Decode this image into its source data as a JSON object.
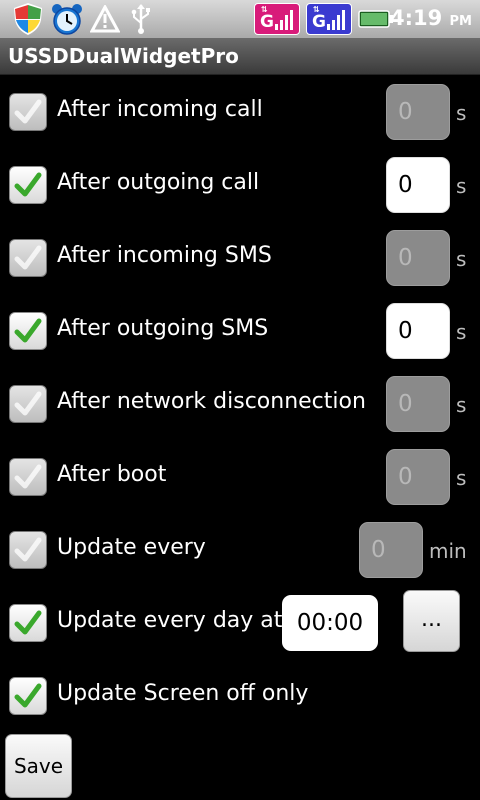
{
  "status_bar": {
    "time": "4:19",
    "ampm": "PM",
    "sim1_label": "G",
    "sim2_label": "G",
    "sim1_color": "#d81b7a",
    "sim2_color": "#3a3ad0",
    "icons": [
      "shield-icon",
      "alarm-clock-icon",
      "warning-icon",
      "usb-icon",
      "battery-icon"
    ]
  },
  "app": {
    "title": "USSDDualWidgetPro"
  },
  "settings": [
    {
      "label": "After incoming call",
      "checked": false,
      "value": "0",
      "unit": "s"
    },
    {
      "label": "After outgoing call",
      "checked": true,
      "value": "0",
      "unit": "s"
    },
    {
      "label": "After incoming SMS",
      "checked": false,
      "value": "0",
      "unit": "s"
    },
    {
      "label": "After outgoing SMS",
      "checked": true,
      "value": "0",
      "unit": "s"
    },
    {
      "label": "After network disconnection",
      "checked": false,
      "value": "0",
      "unit": "s"
    },
    {
      "label": "After boot",
      "checked": false,
      "value": "0",
      "unit": "s"
    },
    {
      "label": "Update every",
      "checked": false,
      "value": "0",
      "unit": "min"
    },
    {
      "label": "Update every day at",
      "checked": true,
      "value": "00:00",
      "picker_label": "..."
    },
    {
      "label": "Update Screen off only",
      "checked": true
    }
  ],
  "save_label": "Save",
  "check_color": "#3aa82c"
}
